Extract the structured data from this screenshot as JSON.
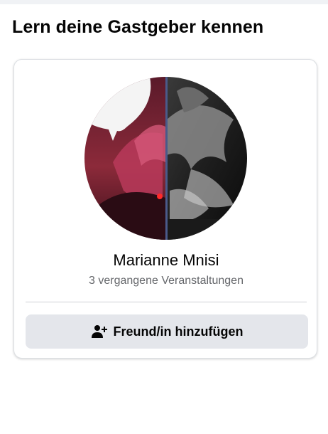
{
  "section": {
    "title": "Lern deine Gastgeber kennen"
  },
  "host": {
    "name": "Marianne Mnisi",
    "meta": "3 vergangene Veranstaltungen",
    "avatar_icon": "user-avatar-icon"
  },
  "action": {
    "add_friend_label": "Freund/in hinzufügen",
    "add_friend_icon": "add-person-icon"
  },
  "colors": {
    "button_bg": "#e4e6eb",
    "secondary_text": "#65676b",
    "primary_text": "#050505"
  }
}
